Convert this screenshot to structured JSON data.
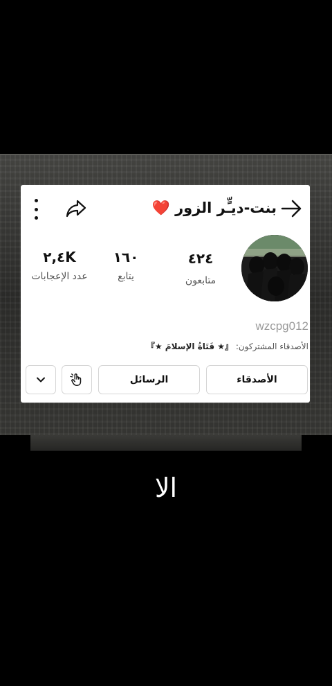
{
  "profile": {
    "display_name": "بنت-ديـٍّر الزور ❤️",
    "username": "wzcpg012",
    "mutual_prefix": "الأصدقاء المشتركون:",
    "mutual_names": "『★ فَتَاةُ الإسلامَ ★』"
  },
  "stats": {
    "followers_value": "٤٢٤",
    "followers_label": "متابعون",
    "following_value": "١٦٠",
    "following_label": "يتابع",
    "likes_value": "٢,٤K",
    "likes_label": "عدد الإعجابات"
  },
  "actions": {
    "friends_label": "الأصدقاء",
    "messages_label": "الرسائل"
  },
  "icons": {
    "back": "arrow-right-icon",
    "share": "share-arrow-icon",
    "more": "vertical-dots-icon",
    "hand": "hand-pointer-icon",
    "dropdown": "chevron-down-icon"
  },
  "caption": "الا"
}
